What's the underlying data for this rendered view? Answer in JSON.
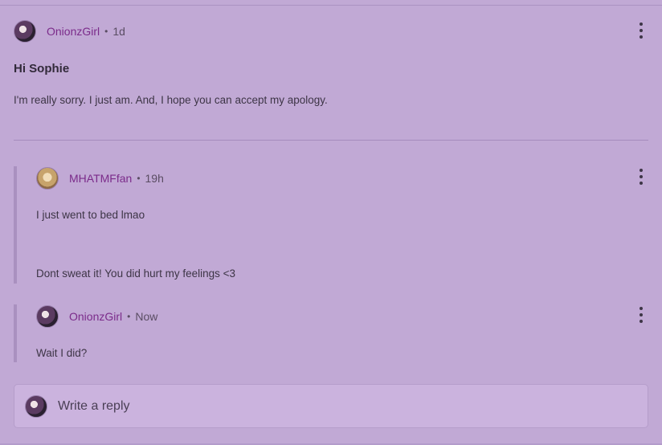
{
  "post": {
    "author": "OnionzGirl",
    "separator": "•",
    "time": "1d",
    "title": "Hi Sophie",
    "body": "I'm really sorry. I just am. And, I hope you can accept my apology."
  },
  "replies": [
    {
      "author": "MHATMFfan",
      "separator": "•",
      "time": "19h",
      "lines": [
        "I just went to bed lmao",
        "Dont sweat it! You did hurt my feelings <3"
      ]
    },
    {
      "author": "OnionzGirl",
      "separator": "•",
      "time": "Now",
      "lines": [
        "Wait I did?"
      ]
    }
  ],
  "reply_input": {
    "placeholder": "Write a reply"
  },
  "icons": {
    "menu": "kebab-menu-icon",
    "avatar": "avatar"
  },
  "colors": {
    "background": "#c1a9d5",
    "username": "#7b2b8a",
    "text": "#3d3546"
  }
}
